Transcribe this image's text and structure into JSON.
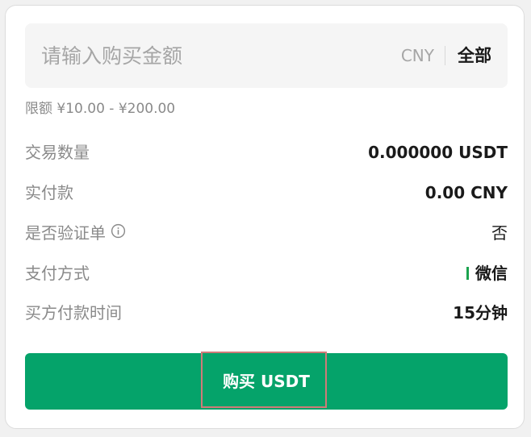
{
  "amount_input": {
    "placeholder": "请输入购买金额",
    "currency": "CNY",
    "all_label": "全部"
  },
  "limit_text": "限额 ¥10.00 - ¥200.00",
  "details": {
    "quantity": {
      "label": "交易数量",
      "value": "0.000000 USDT"
    },
    "actual_payment": {
      "label": "实付款",
      "value": "0.00 CNY"
    },
    "verify_order": {
      "label": "是否验证单",
      "value": "否",
      "icon": "info-circle-icon"
    },
    "payment_method": {
      "label": "支付方式",
      "value": "微信",
      "accent_color": "#1ba34f"
    },
    "payment_time": {
      "label": "买方付款时间",
      "value": "15分钟"
    }
  },
  "buy_button": {
    "label": "购买 USDT",
    "color": "#05a36a"
  }
}
